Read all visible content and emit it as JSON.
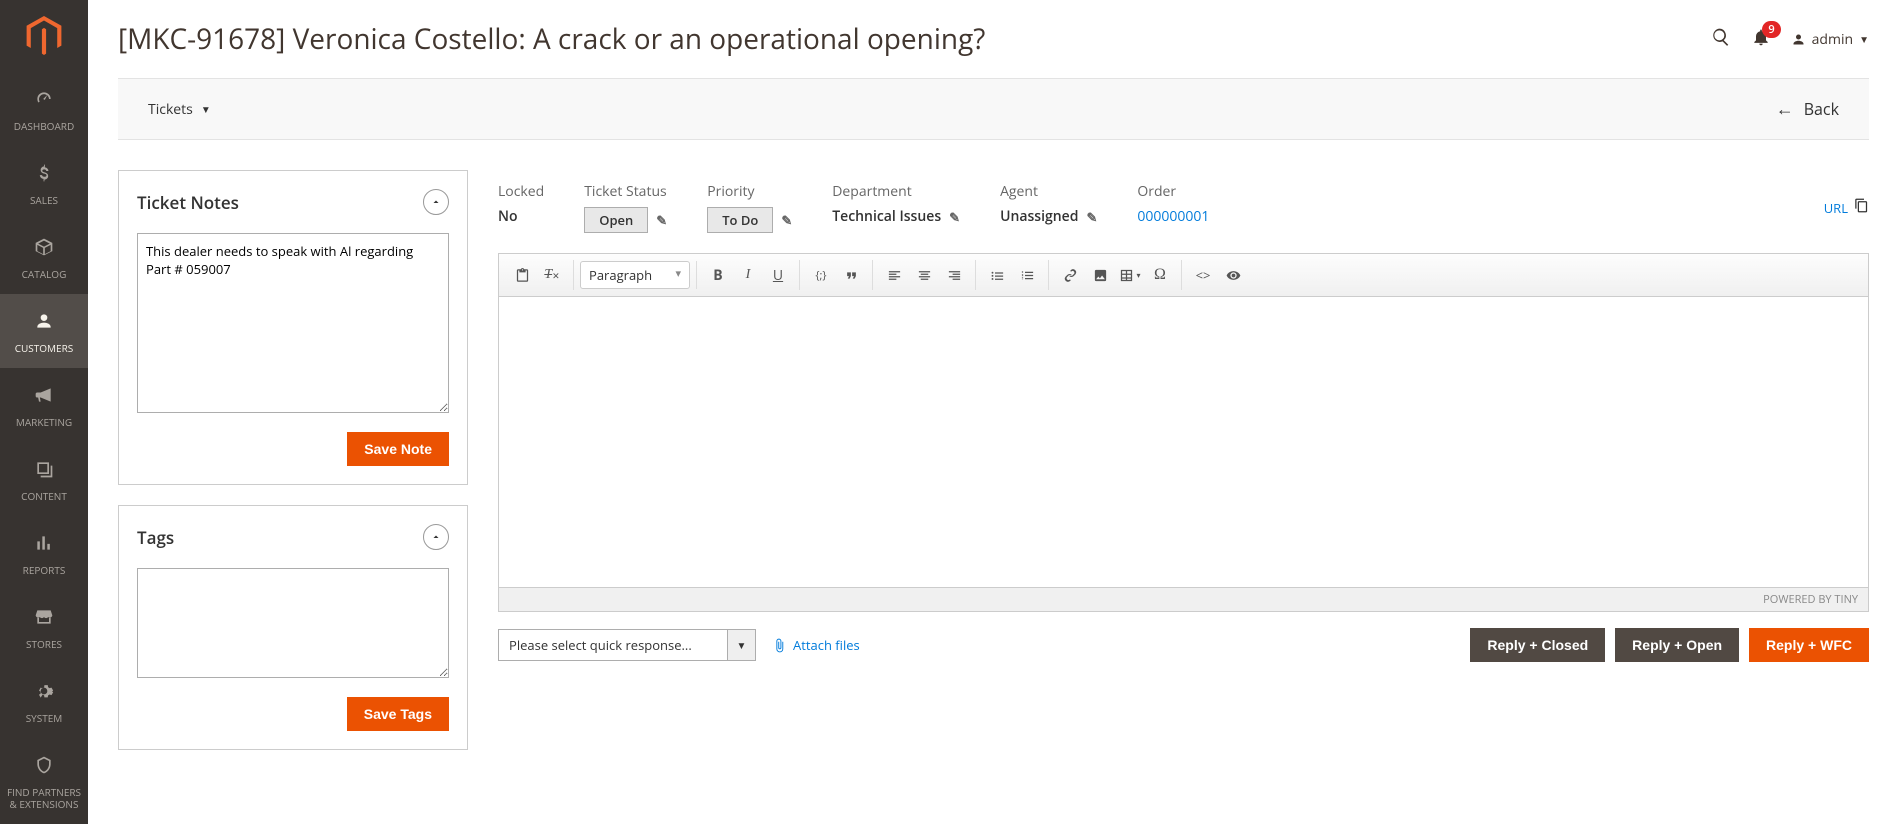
{
  "sidebar": {
    "items": [
      {
        "label": "Dashboard"
      },
      {
        "label": "Sales"
      },
      {
        "label": "Catalog"
      },
      {
        "label": "Customers"
      },
      {
        "label": "Marketing"
      },
      {
        "label": "Content"
      },
      {
        "label": "Reports"
      },
      {
        "label": "Stores"
      },
      {
        "label": "System"
      },
      {
        "label": "Find Partners & Extensions"
      }
    ]
  },
  "header": {
    "title": "[MKC-91678] Veronica Costello: A crack or an operational opening?",
    "notification_count": "9",
    "admin_label": "admin"
  },
  "toolbar": {
    "tickets_label": "Tickets",
    "back_label": "Back"
  },
  "notes_panel": {
    "title": "Ticket Notes",
    "value": "This dealer needs to speak with Al regarding Part # 059007",
    "save_label": "Save Note"
  },
  "tags_panel": {
    "title": "Tags",
    "value": "",
    "save_label": "Save Tags"
  },
  "meta": {
    "locked_label": "Locked",
    "locked_value": "No",
    "status_label": "Ticket Status",
    "status_value": "Open",
    "priority_label": "Priority",
    "priority_value": "To Do",
    "department_label": "Department",
    "department_value": "Technical Issues",
    "agent_label": "Agent",
    "agent_value": "Unassigned",
    "order_label": "Order",
    "order_value": "000000001",
    "url_label": "URL"
  },
  "editor": {
    "paragraph_label": "Paragraph",
    "footer": "POWERED BY TINY"
  },
  "reply": {
    "quick_placeholder": "Please select quick response...",
    "attach_label": "Attach files",
    "btn_closed": "Reply + Closed",
    "btn_open": "Reply + Open",
    "btn_wfc": "Reply + WFC"
  }
}
